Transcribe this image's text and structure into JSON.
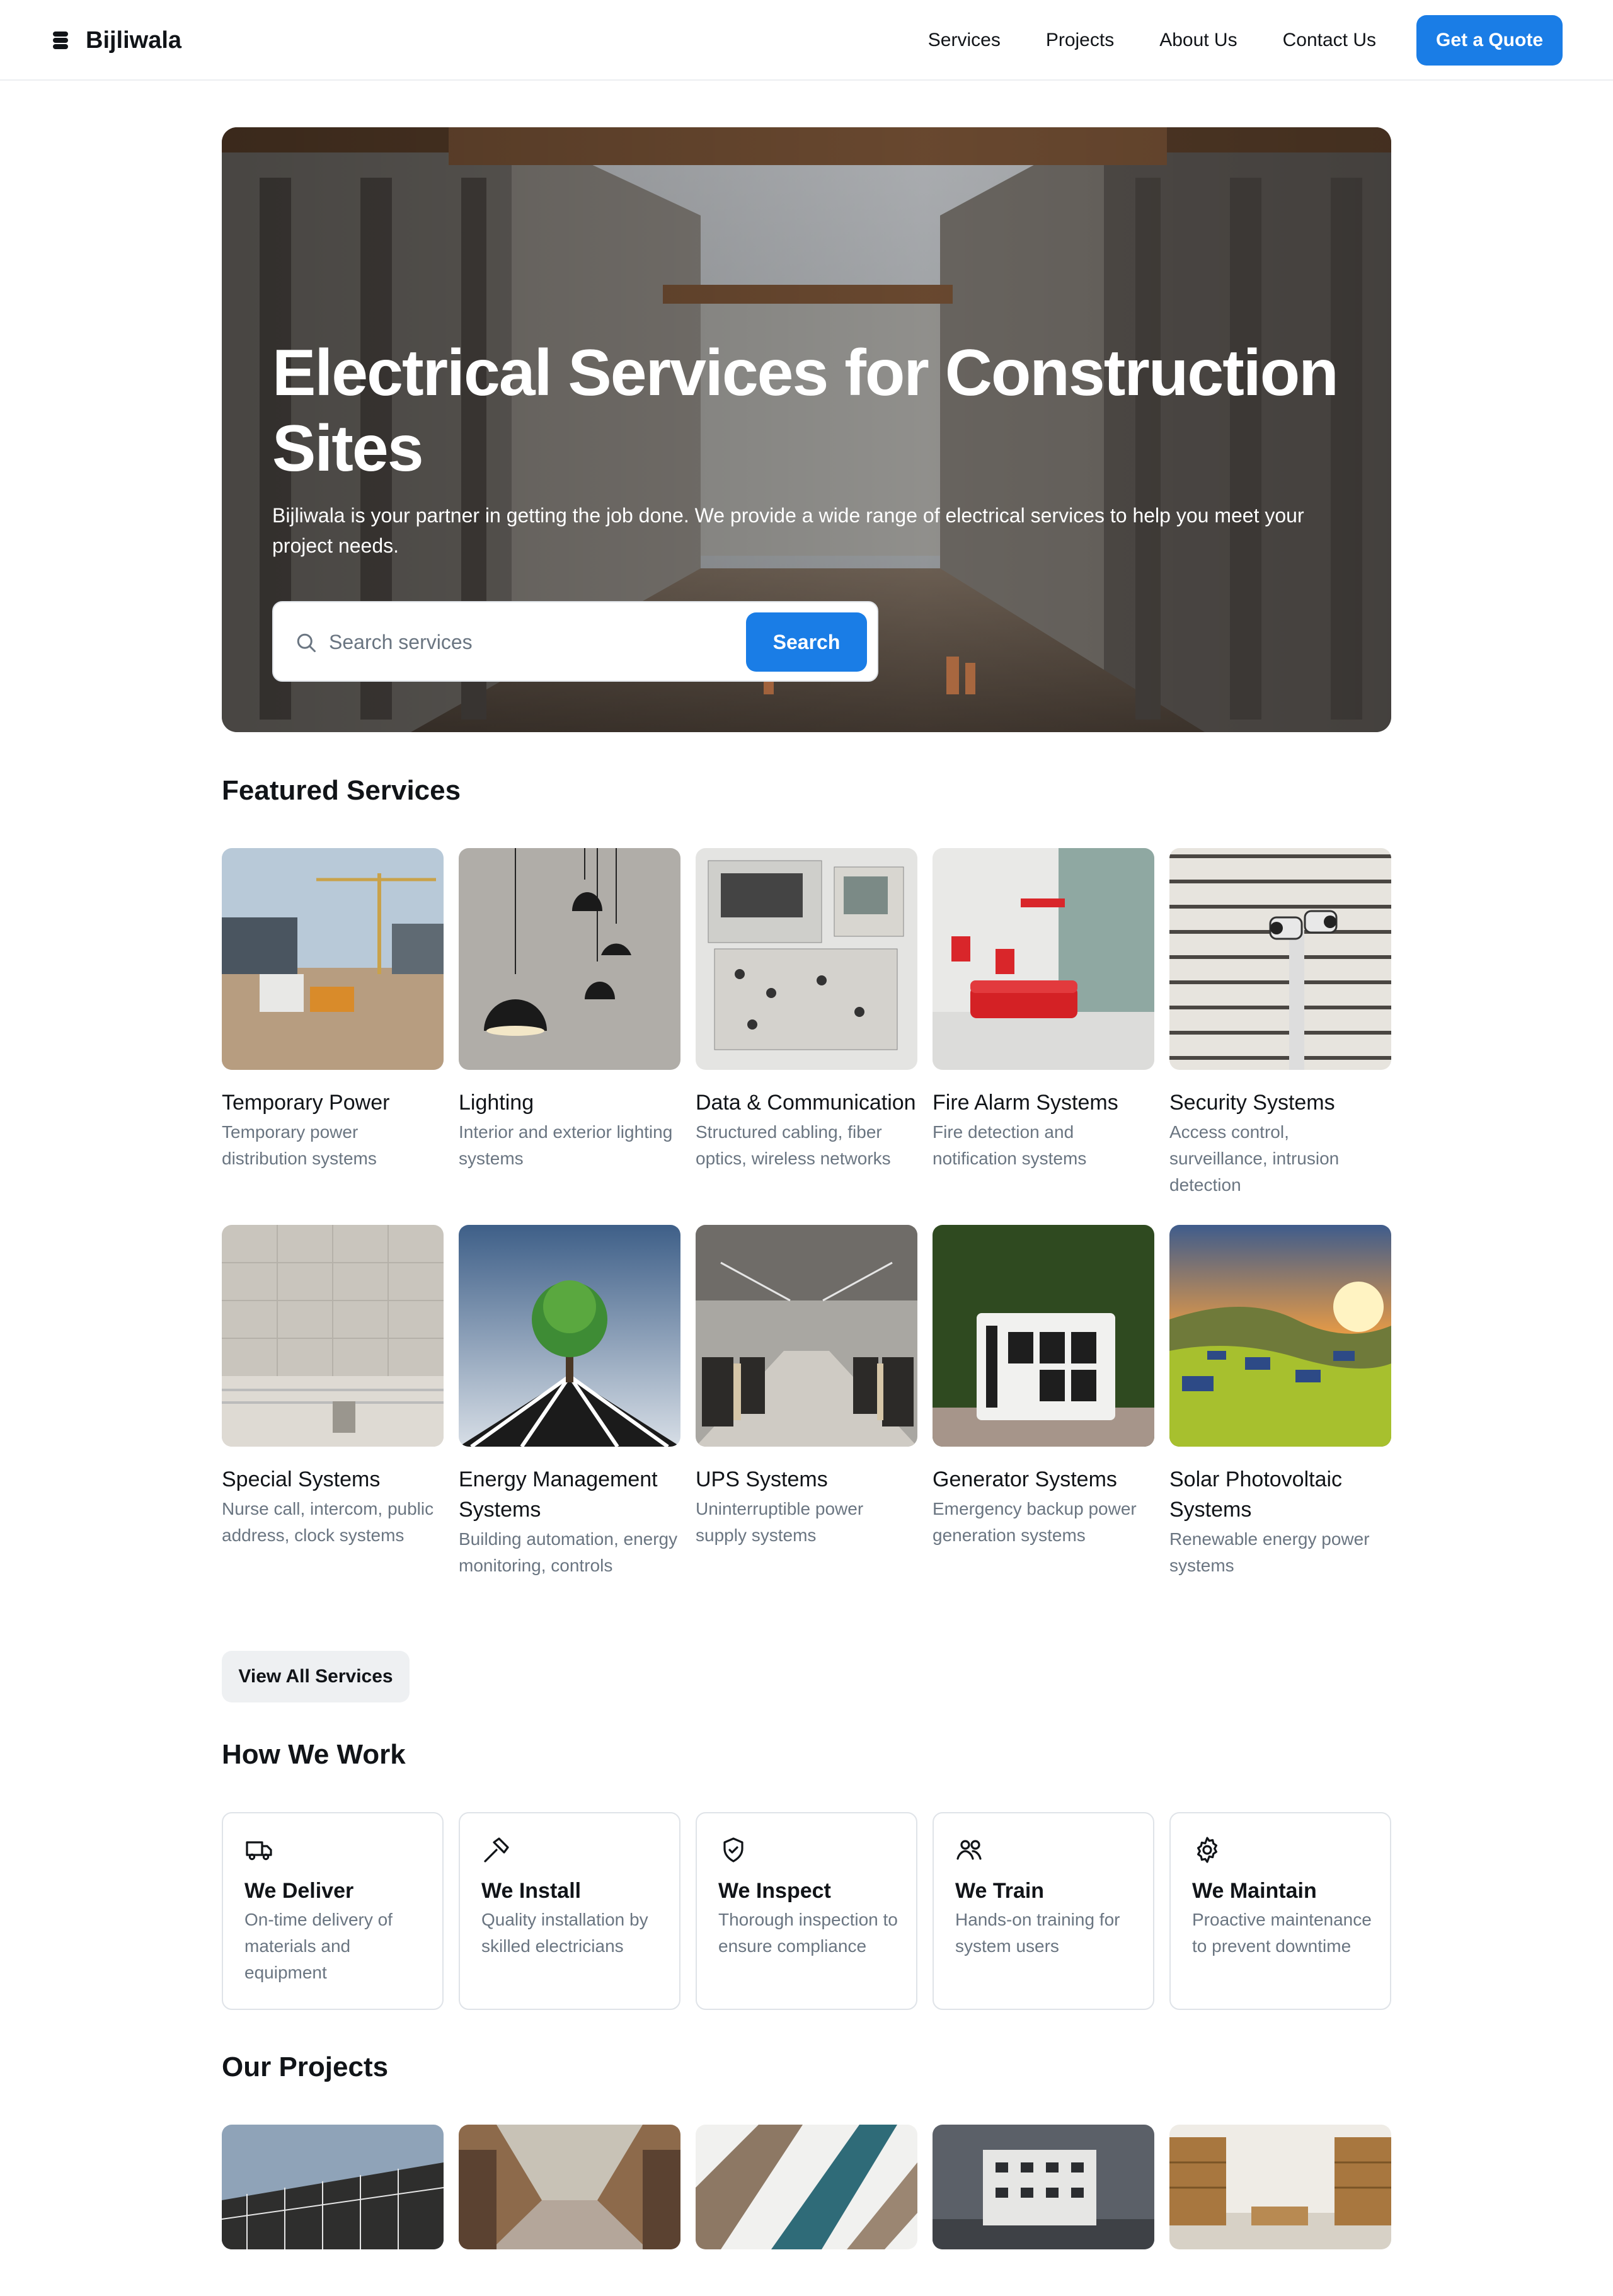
{
  "header": {
    "brand": "Bijliwala",
    "nav": [
      "Services",
      "Projects",
      "About Us",
      "Contact Us"
    ],
    "cta": "Get a Quote"
  },
  "hero": {
    "title": "Electrical Services for Construction Sites",
    "subtitle": "Bijliwala is your partner in getting the job done. We provide a wide range of electrical services to help you meet your project needs.",
    "search_placeholder": "Search services",
    "search_button": "Search"
  },
  "featured": {
    "title": "Featured Services",
    "items": [
      {
        "title": "Temporary Power",
        "desc": "Temporary power distribution systems"
      },
      {
        "title": "Lighting",
        "desc": "Interior and exterior lighting systems"
      },
      {
        "title": "Data & Communication",
        "desc": "Structured cabling, fiber optics, wireless networks"
      },
      {
        "title": "Fire Alarm Systems",
        "desc": "Fire detection and notification systems"
      },
      {
        "title": "Security Systems",
        "desc": "Access control, surveillance, intrusion detection"
      },
      {
        "title": "Special Systems",
        "desc": "Nurse call, intercom, public address, clock systems"
      },
      {
        "title": "Energy Management Systems",
        "desc": "Building automation, energy monitoring, controls"
      },
      {
        "title": "UPS Systems",
        "desc": "Uninterruptible power supply systems"
      },
      {
        "title": "Generator Systems",
        "desc": "Emergency backup power generation systems"
      },
      {
        "title": "Solar Photovoltaic Systems",
        "desc": "Renewable energy power systems"
      }
    ],
    "view_all": "View All Services"
  },
  "how": {
    "title": "How We Work",
    "items": [
      {
        "icon": "truck-icon",
        "title": "We Deliver",
        "desc": "On-time delivery of materials and equipment"
      },
      {
        "icon": "hammer-icon",
        "title": "We Install",
        "desc": "Quality installation by skilled electricians"
      },
      {
        "icon": "shield-check-icon",
        "title": "We Inspect",
        "desc": "Thorough inspection to ensure compliance"
      },
      {
        "icon": "users-icon",
        "title": "We Train",
        "desc": "Hands-on training for system users"
      },
      {
        "icon": "gear-icon",
        "title": "We Maintain",
        "desc": "Proactive maintenance to prevent downtime"
      }
    ]
  },
  "projects": {
    "title": "Our Projects"
  },
  "colors": {
    "accent": "#1a7de6",
    "muted_text": "#6a7581",
    "border": "#dfe3e8"
  }
}
